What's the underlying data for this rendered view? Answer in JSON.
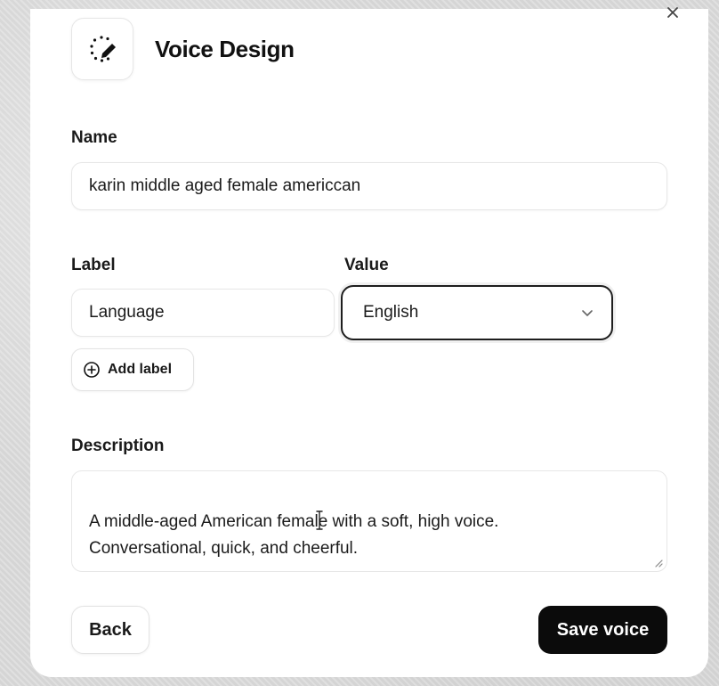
{
  "dialog": {
    "title": "Voice Design",
    "close_icon": "close-icon",
    "logo_icon": "voice-design-icon"
  },
  "name_field": {
    "label": "Name",
    "value": "karin middle aged female americcan"
  },
  "labels_section": {
    "label_heading": "Label",
    "value_heading": "Value",
    "label_value": "Language",
    "selected_value": "English",
    "dropdown_icon": "chevron-down-icon",
    "add_label": "Add label",
    "add_icon": "plus-circle-icon"
  },
  "description_field": {
    "label": "Description",
    "value": "A middle-aged American female with a soft, high voice.\nConversational, quick, and cheerful."
  },
  "footer": {
    "back_label": "Back",
    "save_label": "Save voice"
  },
  "colors": {
    "primary_button": "#0b0b0b",
    "border": "#e7e7e7",
    "focus_border": "#1e1e1e"
  }
}
